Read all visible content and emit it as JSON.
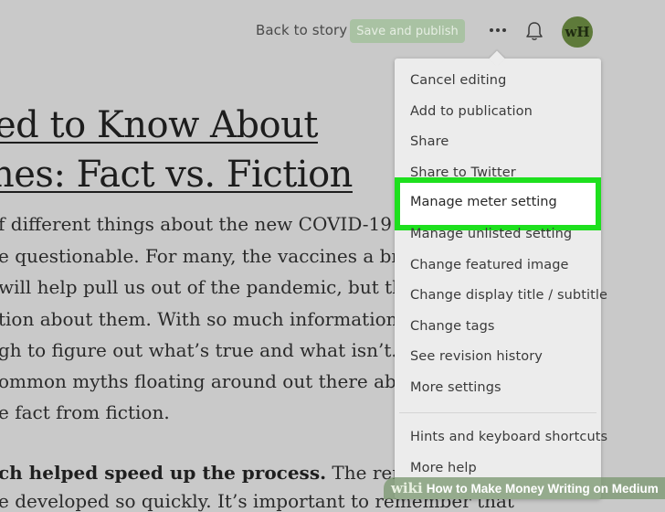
{
  "topbar": {
    "back_label": "Back to story",
    "publish_label": "Save and publish",
    "avatar_initials": "wH"
  },
  "article": {
    "title_lines": [
      "ed to Know About",
      "nes: Fact vs. Fiction"
    ],
    "body_lines": [
      "f different things about the new COVID-19",
      "e questionable. For many, the vaccines a brillia",
      "will help pull us out of the pandemic, but there",
      "tion about them. With so much information be",
      "gh to figure out what’s true and what isn’t. We’",
      "ommon myths floating around out there about",
      "e fact from fiction."
    ],
    "bold_lead": "ch helped speed up the process.",
    "bold_tail": " The remark",
    "last_line": "e developed so quickly. It’s important to remember that"
  },
  "menu": {
    "items": [
      "Cancel editing",
      "Add to publication",
      "Share",
      "Share to Twitter",
      "Manage meter setting",
      "Manage unlisted setting",
      "Change featured image",
      "Change display title / subtitle",
      "Change tags",
      "See revision history",
      "More settings",
      "Hints and keyboard shortcuts",
      "More help"
    ]
  },
  "watermark": {
    "brand": "wiki",
    "title": "How to Make Money Writing on Medium"
  },
  "colors": {
    "highlight": "#1ee01e",
    "publish_button": "#a9c2a3",
    "avatar": "#5e7a3a"
  }
}
